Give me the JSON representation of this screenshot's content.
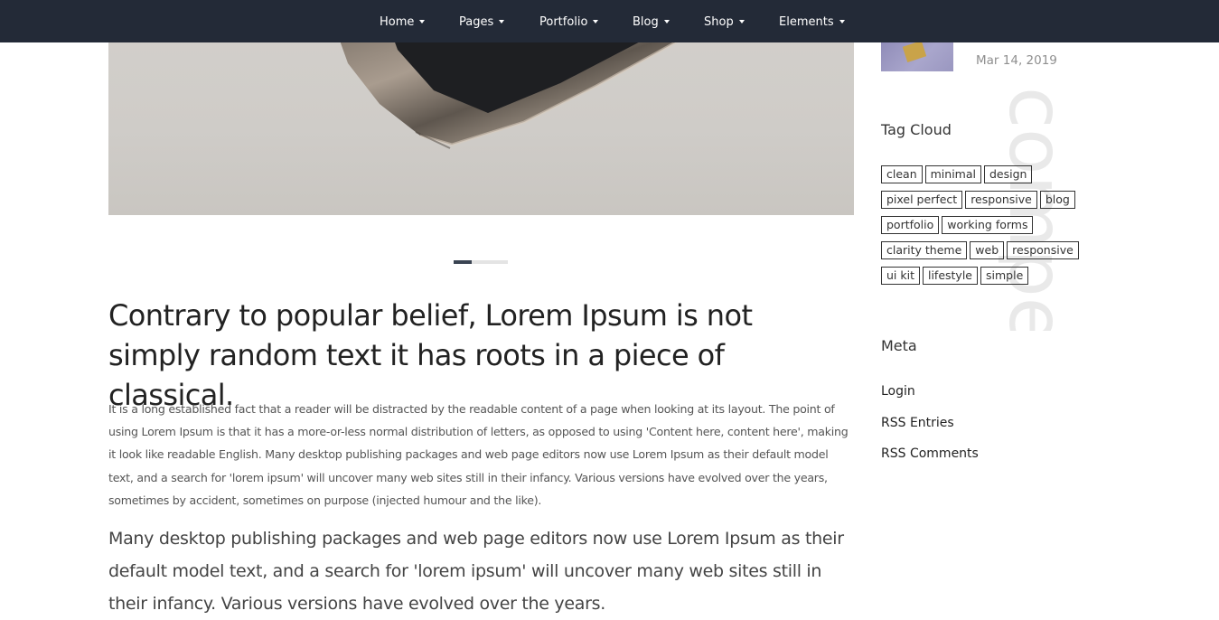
{
  "nav": {
    "items": [
      {
        "label": "Home"
      },
      {
        "label": "Pages"
      },
      {
        "label": "Portfolio"
      },
      {
        "label": "Blog"
      },
      {
        "label": "Shop"
      },
      {
        "label": "Elements"
      }
    ]
  },
  "post": {
    "title": "Contrary to popular belief, Lorem Ipsum is not simply random text it has roots in a piece of classical.",
    "paragraph": "It is a long established fact that a reader will be distracted by the readable content of a page when looking at its layout. The point of using Lorem Ipsum is that it has a more-or-less normal distribution of letters, as opposed to using 'Content here, content here', making it look like readable English. Many desktop publishing packages and web page editors now use Lorem Ipsum as their default model text, and a search for 'lorem ipsum' will uncover many web sites still in their infancy. Various versions have evolved over the years, sometimes by accident, sometimes on purpose (injected humour and the like).",
    "lead": "Many desktop publishing packages and web page editors now use Lorem Ipsum as their default model text, and a search for 'lorem ipsum' will uncover many web sites still in their infancy. Various versions have evolved over the years."
  },
  "carousel": {
    "slide_count": 3,
    "active_index": 0
  },
  "sidebar": {
    "recent_post": {
      "date": "Mar 14, 2019"
    },
    "watermark": "compe",
    "tag_cloud": {
      "title": "Tag Cloud",
      "tags": [
        "clean",
        "minimal",
        "design",
        "pixel perfect",
        "responsive",
        "blog",
        "portfolio",
        "working forms",
        "clarity theme",
        "web",
        "responsive",
        "ui kit",
        "lifestyle",
        "simple"
      ]
    },
    "meta": {
      "title": "Meta",
      "links": [
        "Login",
        "RSS Entries",
        "RSS Comments"
      ]
    }
  },
  "colors": {
    "nav_bg": "#232a37",
    "indicator_active": "#3a4452",
    "indicator_track": "#e4e4e4"
  }
}
